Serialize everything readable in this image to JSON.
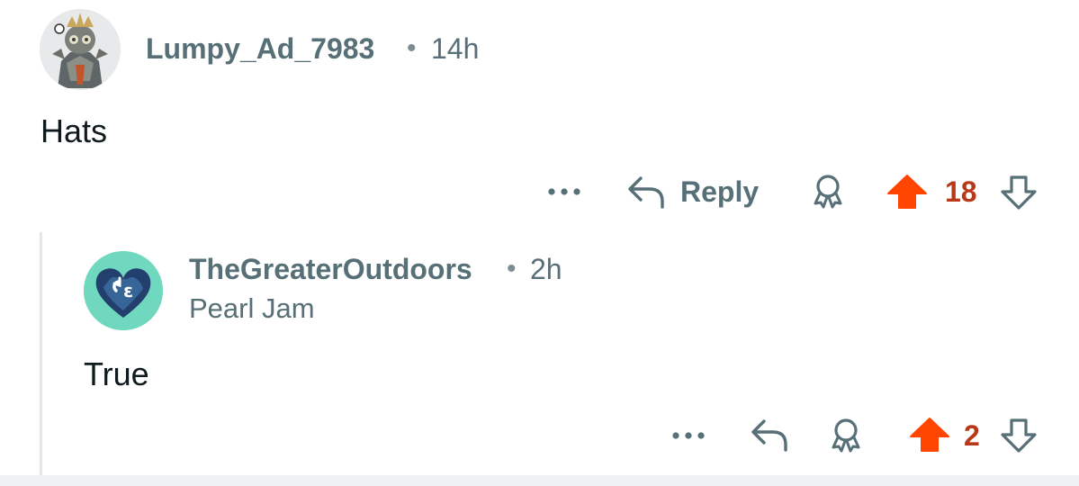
{
  "comments": [
    {
      "username": "Lumpy_Ad_7983",
      "separator": "•",
      "time": "14h",
      "body": "Hats",
      "actions": {
        "more": "•••",
        "reply_label": "Reply",
        "score": "18"
      }
    },
    {
      "username": "TheGreaterOutdoors",
      "separator": "•",
      "time": "2h",
      "flair": "Pearl Jam",
      "body": "True",
      "actions": {
        "more": "•••",
        "score": "2"
      }
    }
  ],
  "colors": {
    "upvote_active": "#ff4500",
    "score_active": "#b8391a",
    "meta_text": "#576f76",
    "avatar2_bg": "#6fd8bf"
  },
  "icons": [
    "more-icon",
    "reply-icon",
    "award-icon",
    "upvote-icon",
    "downvote-icon"
  ]
}
